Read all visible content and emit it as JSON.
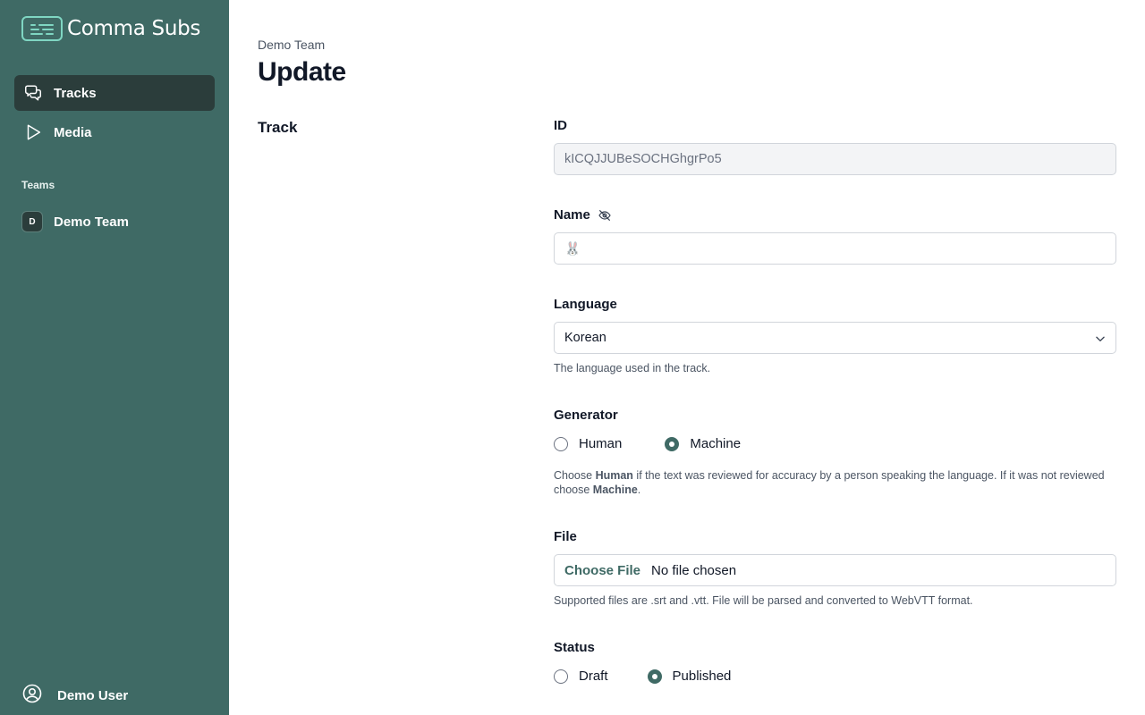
{
  "app": {
    "name": "Comma Subs"
  },
  "nav": {
    "items": [
      {
        "label": "Tracks",
        "icon": "chat-bubbles-icon",
        "active": true
      },
      {
        "label": "Media",
        "icon": "play-icon",
        "active": false
      }
    ],
    "teams_heading": "Teams",
    "teams": [
      {
        "initial": "D",
        "name": "Demo Team"
      }
    ],
    "user": {
      "name": "Demo User",
      "icon": "user-circle-icon"
    }
  },
  "page": {
    "breadcrumb": "Demo Team",
    "title": "Update",
    "section": "Track"
  },
  "form": {
    "id": {
      "label": "ID",
      "value": "kICQJJUBeSOCHGhgrPo5"
    },
    "name": {
      "label": "Name",
      "value": "🐰",
      "icon": "eye-off-icon"
    },
    "language": {
      "label": "Language",
      "value": "Korean",
      "help": "The language used in the track."
    },
    "generator": {
      "label": "Generator",
      "options": [
        "Human",
        "Machine"
      ],
      "selected": "Machine",
      "help": {
        "p1": "Choose ",
        "b1": "Human",
        "p2": " if the text was reviewed for accuracy by a person speaking the language. If it was not reviewed choose ",
        "b2": "Machine",
        "p3": "."
      }
    },
    "file": {
      "label": "File",
      "button": "Choose File",
      "status": "No file chosen",
      "help": "Supported files are .srt and .vtt. File will be parsed and converted to WebVTT format."
    },
    "status": {
      "label": "Status",
      "options": [
        "Draft",
        "Published"
      ],
      "selected": "Published"
    }
  },
  "colors": {
    "sidebar": "#3f6a65",
    "active_nav": "#2b3d3b",
    "accent": "#3f6a65",
    "logo": "#7fd6c2"
  }
}
